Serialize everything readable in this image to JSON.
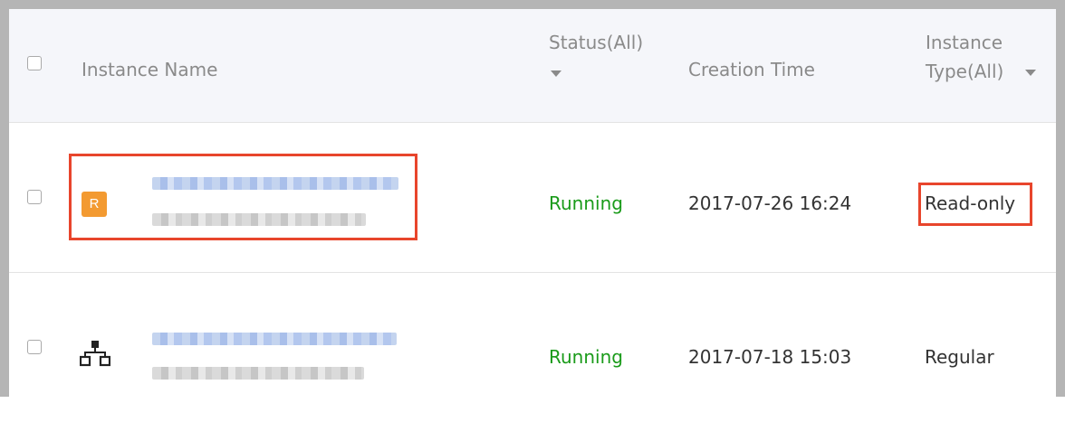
{
  "table": {
    "columns": {
      "instance_name": "Instance Name",
      "status": "Status(All)",
      "creation_time": "Creation Time",
      "instance_type_line1": "Instance",
      "instance_type_line2": "Type(All)"
    },
    "rows": [
      {
        "icon": "read-only-badge",
        "badge_letter": "R",
        "status": "Running",
        "creation_time": "2017-07-26 16:24",
        "instance_type": "Read-only",
        "highlighted": true
      },
      {
        "icon": "topology-icon",
        "status": "Running",
        "creation_time": "2017-07-18 15:03",
        "instance_type": "Regular",
        "highlighted": false
      }
    ]
  },
  "colors": {
    "running_status": "#1a9b1a",
    "highlight_border": "#e8452c",
    "read_only_badge": "#f39a31",
    "header_background": "#f5f6fa",
    "window_border": "#b5b5b5"
  }
}
